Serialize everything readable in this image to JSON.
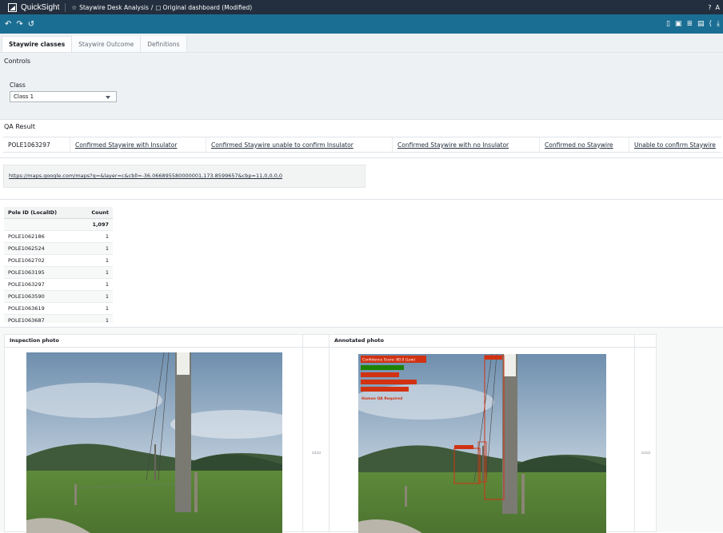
{
  "app": {
    "name": "QuickSight"
  },
  "breadcrumb": {
    "analysis": "Staywire Desk Analysis",
    "separator": "/",
    "dashboard": "Original dashboard (Modified)"
  },
  "tabs": [
    {
      "label": "Staywire classes",
      "active": true
    },
    {
      "label": "Staywire Outcome",
      "active": false
    },
    {
      "label": "Definitions",
      "active": false
    }
  ],
  "controls": {
    "title": "Controls",
    "class_label": "Class",
    "class_value": "Class 1"
  },
  "qa": {
    "title": "QA Result",
    "pole": "POLE1063297",
    "options": [
      "Confirmed Staywire with Insulator",
      "Confirmed Staywire unable to confirm Insulator",
      "Confirmed Staywire with no Insulator",
      "Confirmed no Staywire",
      "Unable to confirm Staywire"
    ]
  },
  "url": "https://maps.google.com/maps?q=&layer=c&cbll=-36.066895580000001,173.8599657&cbp=11,0,0,0,0",
  "pivot": {
    "headers": [
      "Pole ID (LocalID)",
      "Count"
    ],
    "total": "1,097",
    "rows": [
      {
        "id": "POLE1062186",
        "count": "1"
      },
      {
        "id": "POLE1062524",
        "count": "1"
      },
      {
        "id": "POLE1062702",
        "count": "1"
      },
      {
        "id": "POLE1063195",
        "count": "1"
      },
      {
        "id": "POLE1063297",
        "count": "1"
      },
      {
        "id": "POLE1063590",
        "count": "1"
      },
      {
        "id": "POLE1063619",
        "count": "1"
      },
      {
        "id": "POLE1063687",
        "count": "1"
      }
    ]
  },
  "photos": {
    "inspection_title": "Inspection photo",
    "annotated_title": "Annotated photo",
    "annotations": {
      "confidence": "Confidence Score: 80.0 (Low)",
      "human_qa": "Human QA Required"
    }
  },
  "colors": {
    "topbar": "#232f3e",
    "toolbar": "#1b6e93",
    "annotation_red": "#d13212",
    "annotation_green": "#1d8102"
  },
  "icons": [
    "help-icon",
    "user-icon",
    "undo-icon",
    "redo-icon",
    "reset-icon",
    "bookmark-icon",
    "share-icon",
    "expand-icon"
  ]
}
